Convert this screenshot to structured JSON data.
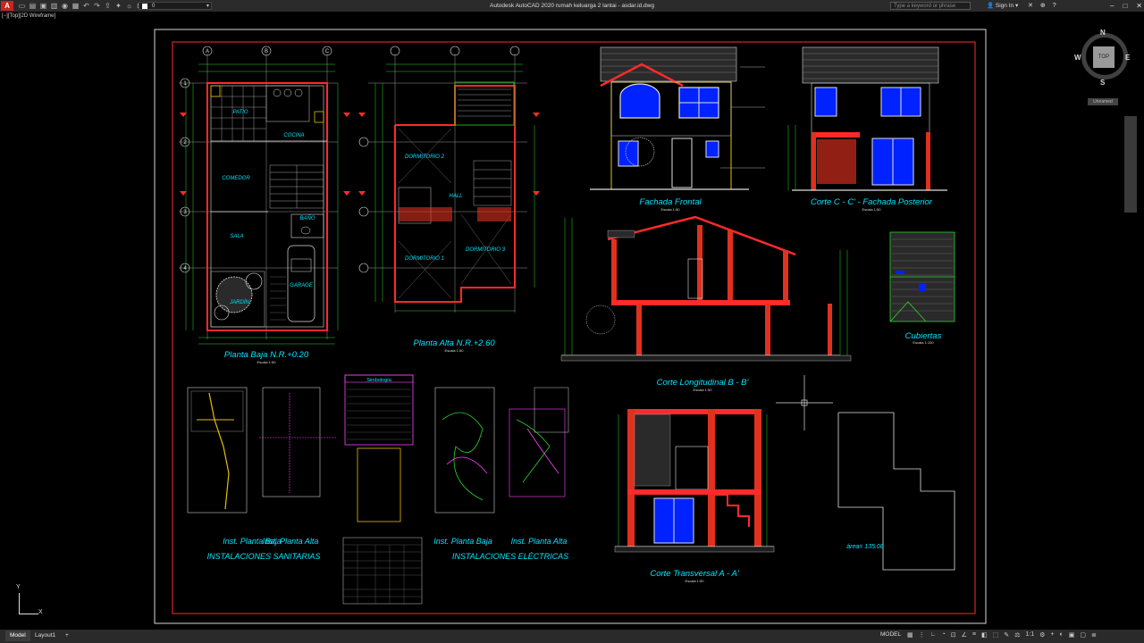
{
  "titlebar": {
    "app_title": "Autodesk AutoCAD 2020   rumah keluarga 2 lantai - asdar.id.dwg",
    "search_placeholder": "Type a keyword or phrase",
    "signin": "Sign In",
    "layer_value": "0"
  },
  "viewport_label": "[−][Top][2D Wireframe]",
  "viewcube": {
    "top": "TOP",
    "north": "N",
    "south": "S",
    "east": "E",
    "west": "W",
    "ucs_name": "Unnamed"
  },
  "ucs": {
    "y": "Y",
    "x": "X"
  },
  "drawing": {
    "plan_ground_title": "Planta Baja N.R.+0.20",
    "plan_upper_title": "Planta Alta N.R.+2.60",
    "facade_title": "Fachada Frontal",
    "section_cc_title": "Corte C - C' - Fachada Posterior",
    "roof_title": "Cubiertas",
    "section_bb_title": "Corte Longitudinal B - B'",
    "section_aa_title": "Corte Transversal A - A'",
    "scale_50": "Escala 1:50",
    "scale_100": "Escala 1:100",
    "inst_san_ground": "Inst. Planta Baja",
    "inst_san_upper": "Inst. Planta Alta",
    "inst_san_title": "INSTALACIONES SANITARIAS",
    "inst_ele_ground": "Inst. Planta Baja",
    "inst_ele_upper": "Inst. Planta Alta",
    "inst_ele_title": "INSTALACIONES ELÉCTRICAS",
    "simbologia": "Simbología",
    "area_label": "área= 135.08",
    "rooms_ground": [
      "PATIO",
      "COCINA",
      "COMEDOR",
      "BAÑO",
      "SALA",
      "JARDÍN",
      "GARAGE"
    ],
    "rooms_upper": [
      "DORMITORIO 2",
      "HALL",
      "DORMITORIO 1",
      "DORMITORIO 3"
    ],
    "axes_letters": [
      "A",
      "B",
      "C"
    ],
    "axes_numbers": [
      "1",
      "2",
      "3",
      "4"
    ]
  },
  "status": {
    "tab_model": "Model",
    "tab_layout": "Layout1",
    "add": "+",
    "mode": "MODEL",
    "scale": "1:1"
  },
  "colors": {
    "frame_red": "#ff2a2a",
    "cyan": "#00e5ff",
    "wall_red": "#e0301e",
    "blue_fill": "#0022ff",
    "green": "#2ad62a",
    "magenta": "#ff44ff"
  }
}
